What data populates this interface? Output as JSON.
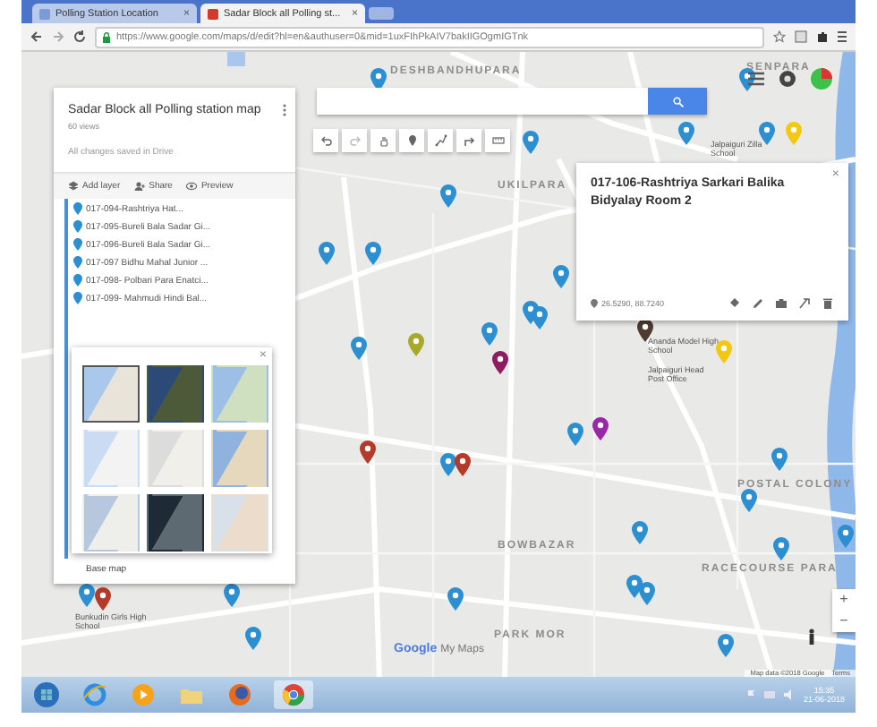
{
  "browser": {
    "tabs": [
      {
        "title": "Polling Station Location",
        "close": "×",
        "selected": false
      },
      {
        "title": "Sadar Block all Polling st...",
        "close": "×",
        "selected": true
      }
    ],
    "url": "https://www.google.com/maps/d/edit?hl=en&authuser=0&mid=1uxFIhPkAIV7bakIIGOgmIGTnk"
  },
  "map_panel": {
    "title": "Sadar Block all Polling station map",
    "views": "60 views",
    "status": "All changes saved in Drive",
    "actions": [
      {
        "kind": "layer",
        "label": "Add layer"
      },
      {
        "kind": "share",
        "label": "Share"
      },
      {
        "kind": "preview",
        "label": "Preview"
      }
    ],
    "items": [
      "017-094-Rashtriya Hat...",
      "017-095-Bureli Bala Sadar Gi...",
      "017-096-Bureli Bala Sadar Gi...",
      "017-097 Bidhu Mahal Junior ...",
      "017-098- Polbari Para Enatci...",
      "017-099- Mahmudi Hindi Bal..."
    ],
    "base_map_label": "Base map"
  },
  "base_map_popup": {
    "close": "×",
    "styles": [
      {
        "kind": "map",
        "selected": true
      },
      {
        "kind": "satellite",
        "selected": false
      },
      {
        "kind": "terrain",
        "selected": false
      },
      {
        "kind": "light",
        "selected": false
      },
      {
        "kind": "mono",
        "selected": false
      },
      {
        "kind": "simple",
        "selected": false
      },
      {
        "kind": "pale",
        "selected": false
      },
      {
        "kind": "dark",
        "selected": false
      },
      {
        "kind": "warm",
        "selected": false
      }
    ]
  },
  "info_card": {
    "title": "017-106-Rashtriya Sarkari Balika Bidyalay Room 2",
    "coords": "26.5290, 88.7240",
    "close": "×"
  },
  "map_labels": [
    {
      "kind": "area",
      "text": "DESHBANDHUPARA"
    },
    {
      "kind": "area",
      "text": "SENPARA"
    },
    {
      "kind": "place",
      "text": "Jalpaiguri Zilla School"
    },
    {
      "kind": "area",
      "text": "UKILPARA"
    },
    {
      "kind": "place",
      "text": "Ananda Model High School"
    },
    {
      "kind": "place",
      "text": "Jalpaiguri Head Post Office"
    },
    {
      "kind": "area",
      "text": "POSTAL COLONY"
    },
    {
      "kind": "area",
      "text": "BOWBAZAR"
    },
    {
      "kind": "area",
      "text": "RACECOURSE PARA"
    },
    {
      "kind": "place",
      "text": "Bunkudin Girls High School"
    },
    {
      "kind": "area",
      "text": "PARK MOR"
    }
  ],
  "markers": [
    {
      "color": "#2b8fd1"
    },
    {
      "color": "#2b8fd1"
    },
    {
      "color": "#2b8fd1"
    },
    {
      "color": "#2b8fd1"
    },
    {
      "color": "#f2c811"
    },
    {
      "color": "#2b8fd1"
    },
    {
      "color": "#2b8fd1"
    },
    {
      "color": "#2b8fd1"
    },
    {
      "color": "#2b8fd1"
    },
    {
      "color": "#2b8fd1"
    },
    {
      "color": "#2b8fd1"
    },
    {
      "color": "#2b8fd1"
    },
    {
      "color": "#2b8fd1"
    },
    {
      "color": "#a8a82c"
    },
    {
      "color": "#2b8fd1"
    },
    {
      "color": "#4e3b31"
    },
    {
      "color": "#f2c811"
    },
    {
      "color": "#8e1c5e"
    },
    {
      "color": "#b53a2a"
    },
    {
      "color": "#2b8fd1"
    },
    {
      "color": "#b53a2a"
    },
    {
      "color": "#2b8fd1"
    },
    {
      "color": "#9b27a8"
    },
    {
      "color": "#2b8fd1"
    },
    {
      "color": "#2b8fd1"
    },
    {
      "color": "#2b8fd1"
    },
    {
      "color": "#2b8fd1"
    },
    {
      "color": "#2b8fd1"
    },
    {
      "color": "#2b8fd1"
    },
    {
      "color": "#2b8fd1"
    },
    {
      "color": "#2b8fd1"
    },
    {
      "color": "#2b8fd1"
    },
    {
      "color": "#2b8fd1"
    },
    {
      "color": "#b53a2a"
    },
    {
      "color": "#2b8fd1"
    },
    {
      "color": "#2b8fd1"
    }
  ],
  "logo": {
    "wordmark": "Google",
    "product": "My Maps"
  },
  "attribution": {
    "text": "Map data ©2018 Google",
    "terms": "Terms"
  },
  "zoom": {
    "in": "+",
    "out": "−"
  },
  "taskbar": {
    "time": "15:35",
    "date": "21-06-2018"
  }
}
